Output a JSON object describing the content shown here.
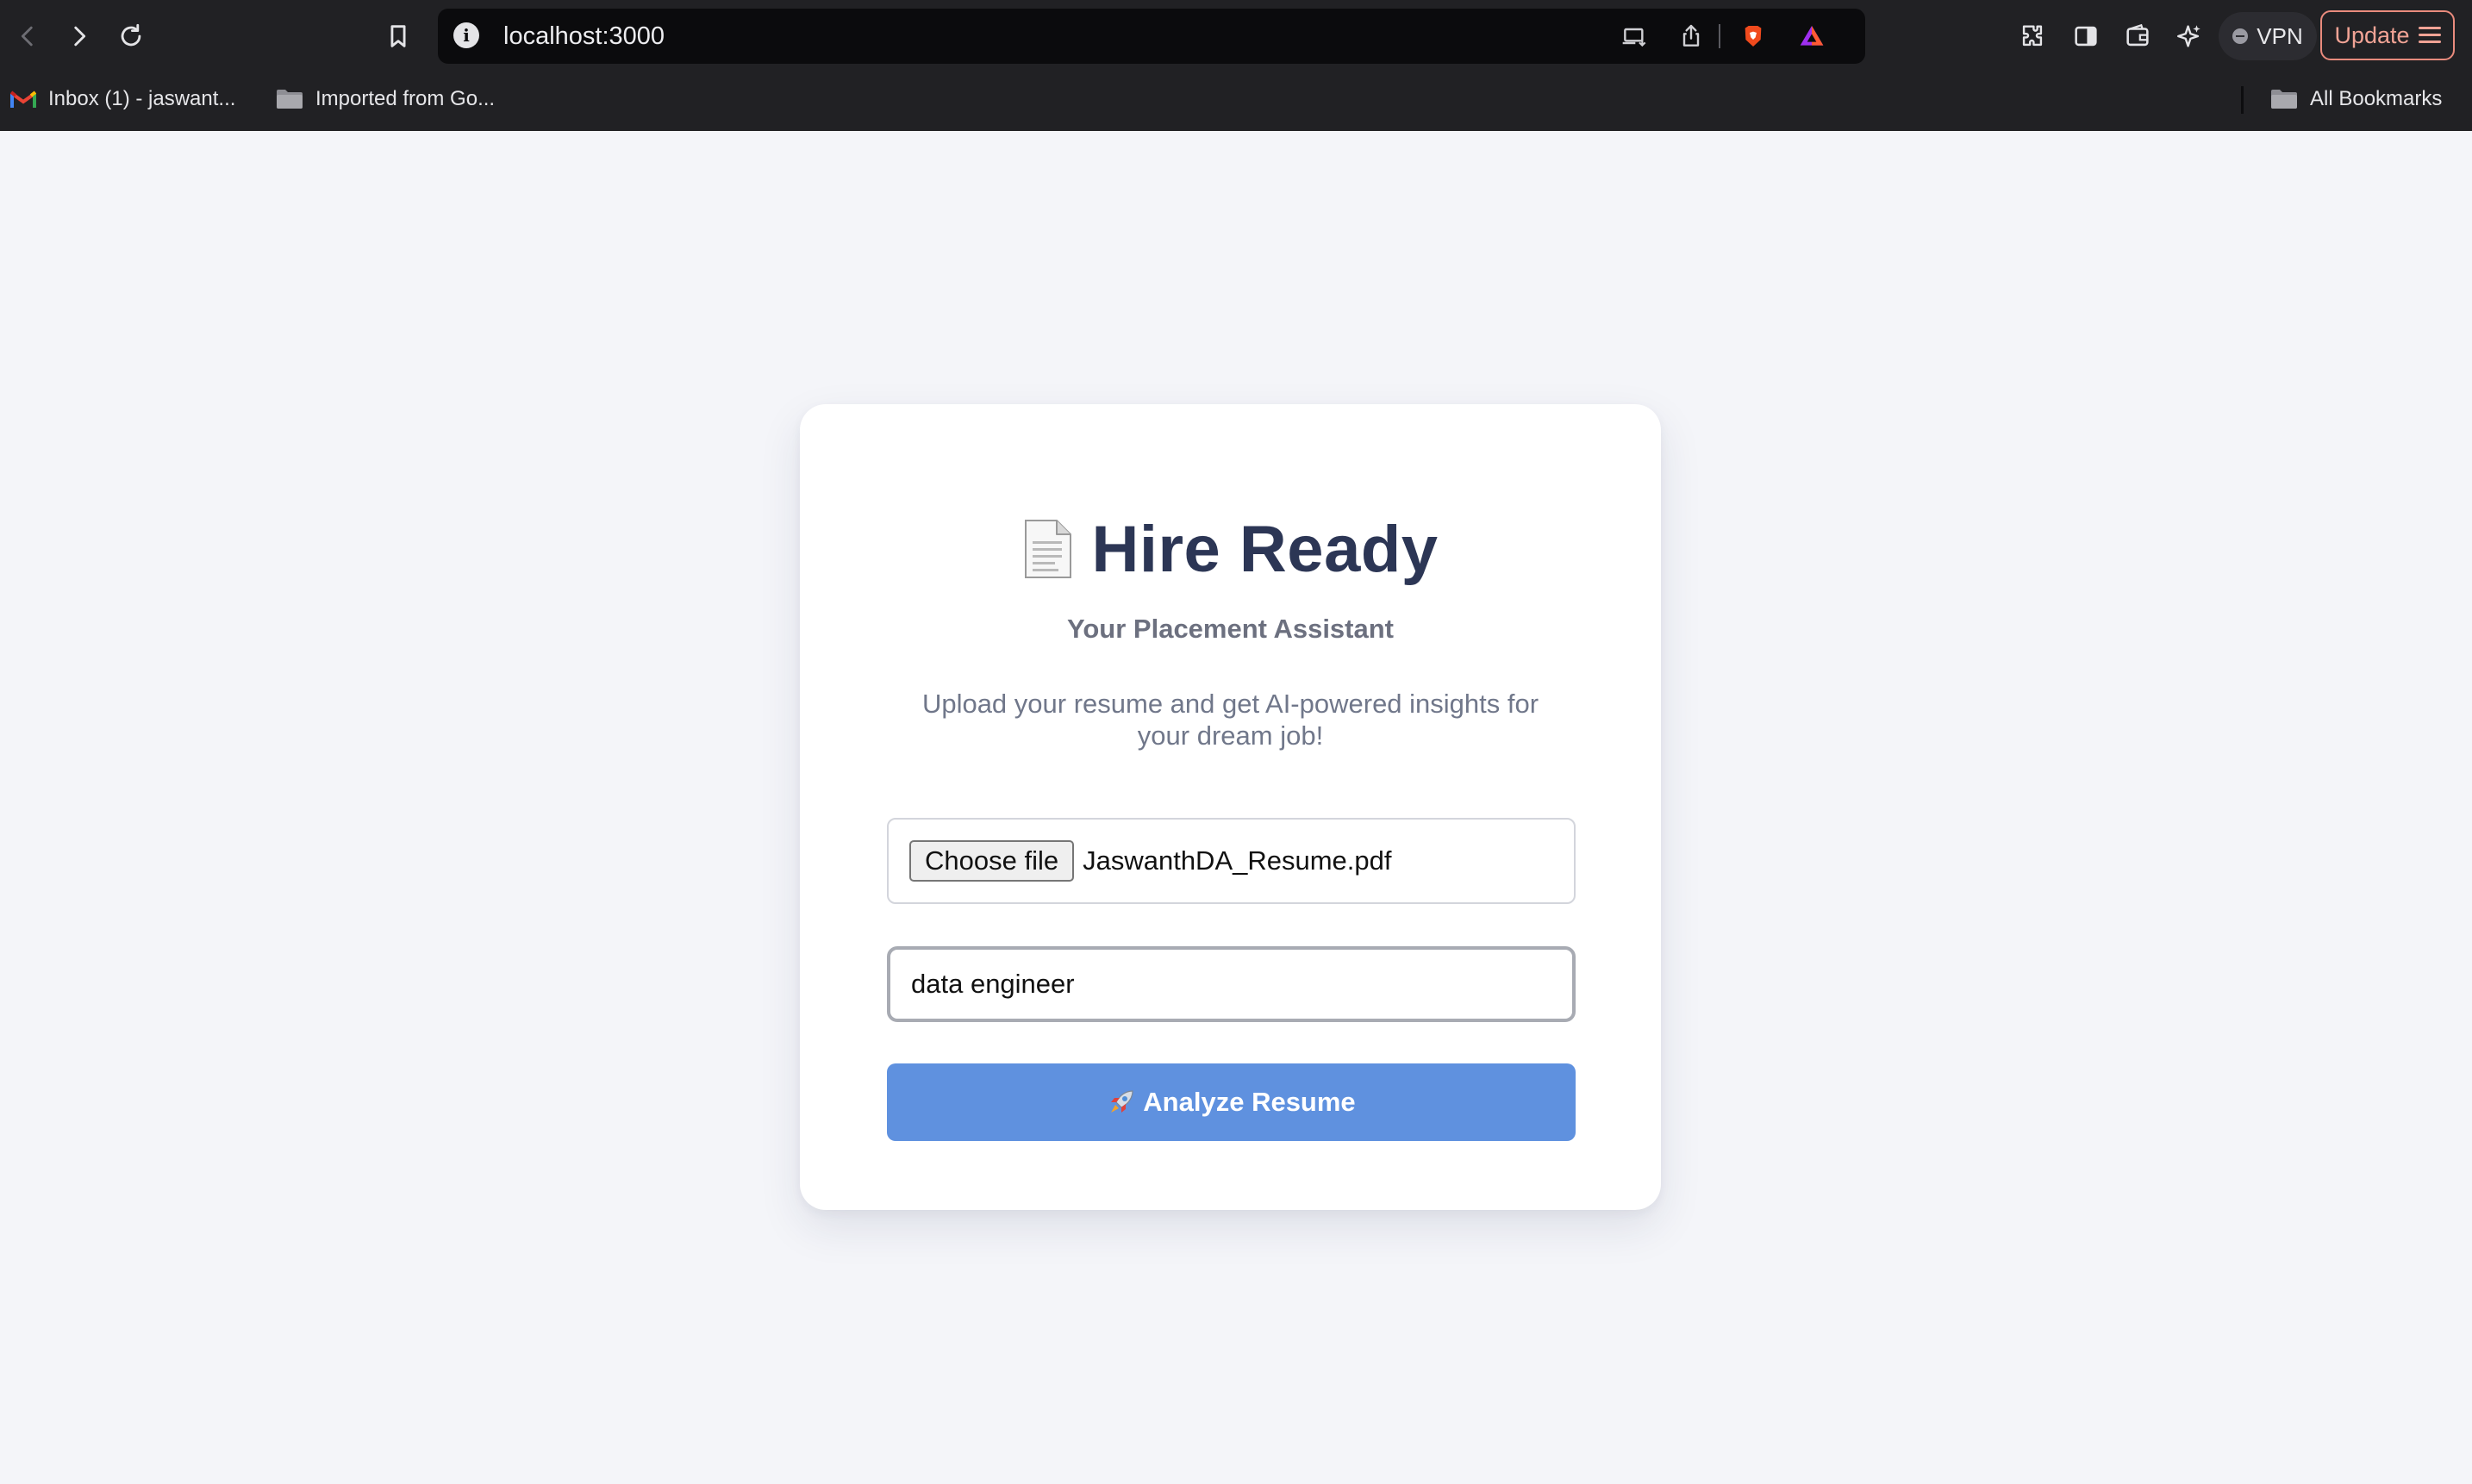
{
  "browser": {
    "url": "localhost:3000",
    "vpn_label": "VPN",
    "update_label": "Update",
    "bookmarks": [
      {
        "label": "Inbox (1) - jaswant...",
        "icon": "gmail-icon"
      },
      {
        "label": "Imported from Go...",
        "icon": "folder-icon"
      }
    ],
    "all_bookmarks_label": "All Bookmarks",
    "toolbar_icons": [
      "back-icon",
      "forward-icon",
      "reload-icon",
      "bookmark-icon",
      "site-info-icon",
      "install-app-icon",
      "share-icon",
      "brave-shields-icon",
      "brave-rewards-icon",
      "extensions-icon",
      "sidebar-icon",
      "wallet-icon",
      "leo-ai-icon"
    ]
  },
  "app": {
    "title": "Hire Ready",
    "title_icon": "document-icon",
    "subtitle": "Your Placement Assistant",
    "description": "Upload your resume and get AI-powered insights for your dream job!",
    "file_upload": {
      "button_label": "Choose file",
      "file_name": "JaswanthDA_Resume.pdf"
    },
    "role_input": {
      "value": "data engineer"
    },
    "analyze_button": {
      "label": "Analyze Resume",
      "icon": "rocket-icon"
    }
  },
  "colors": {
    "page_background": "#f4f5f9",
    "title": "#2c3655",
    "button": "#5f91df",
    "update_accent": "#e98b7d"
  }
}
